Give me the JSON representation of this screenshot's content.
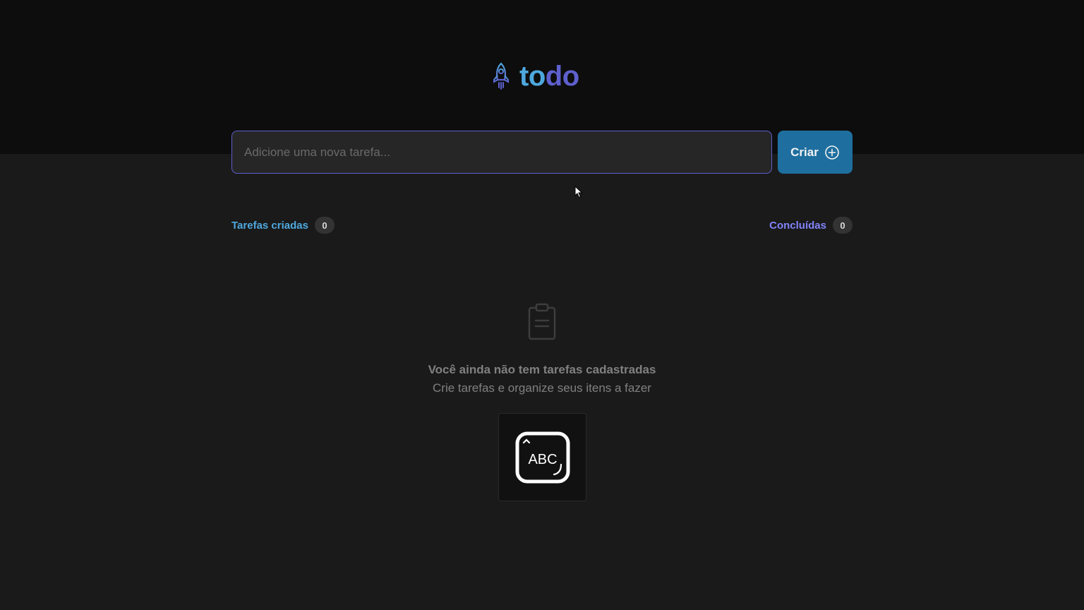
{
  "logo": {
    "text_part1": "to",
    "text_part2": "do",
    "icon": "rocket-icon"
  },
  "new_task": {
    "placeholder": "Adicione uma nova tarefa...",
    "value": ""
  },
  "create_button": {
    "label": "Criar",
    "icon": "plus-circle-icon"
  },
  "counters": {
    "created_label": "Tarefas criadas",
    "created_count": "0",
    "done_label": "Concluídas",
    "done_count": "0"
  },
  "empty_state": {
    "icon": "clipboard-icon",
    "title": "Você ainda não tem tarefas cadastradas",
    "subtitle": "Crie tarefas e organize seus itens a fazer"
  },
  "keyboard_popup": {
    "icon": "keyboard-input-icon",
    "text": "ABC"
  },
  "colors": {
    "header_bg": "#0d0d0d",
    "body_bg": "#1a1a1a",
    "blue": "#4ea8de",
    "purple": "#8284fa",
    "purple_dark": "#5e60ce",
    "button": "#1e6f9f"
  }
}
